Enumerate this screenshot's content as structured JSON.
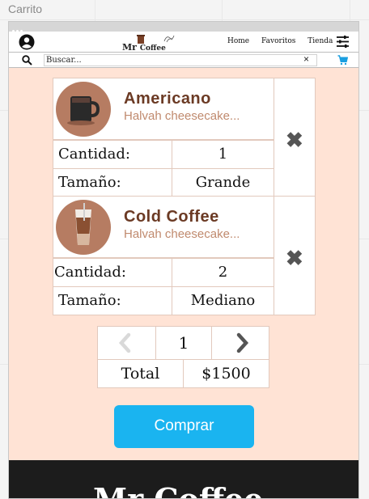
{
  "screen": {
    "title": "Carrito"
  },
  "header": {
    "logo_text": "Mr",
    "logo_text_2": "Coffee",
    "nav": [
      "Home",
      "Favoritos",
      "Tienda"
    ]
  },
  "search": {
    "value": "Buscar...",
    "clear_symbol": "×"
  },
  "cart": {
    "items": [
      {
        "name": "Americano",
        "description": "Halvah cheesecake...",
        "quantity_label": "Cantidad:",
        "quantity": "1",
        "size_label": "Tamaño:",
        "size": "Grande",
        "thumb_icon": "hot-coffee-cup",
        "remove_symbol": "✖"
      },
      {
        "name": "Cold Coffee",
        "description": "Halvah cheesecake...",
        "quantity_label": "Cantidad:",
        "quantity": "2",
        "size_label": "Tamaño:",
        "size": "Mediano",
        "thumb_icon": "iced-coffee-glass",
        "remove_symbol": "✖"
      }
    ]
  },
  "pager": {
    "current_page": "1"
  },
  "totals": {
    "label": "Total",
    "value": "$1500"
  },
  "actions": {
    "buy_label": "Comprar"
  },
  "footer": {
    "brand": "Mr Coffee"
  },
  "colors": {
    "background": "#ffe3d5",
    "item_title": "#6b3a24",
    "item_description": "#c08a6e",
    "accent": "#1ab4f0",
    "footer": "#1c1c1c"
  }
}
